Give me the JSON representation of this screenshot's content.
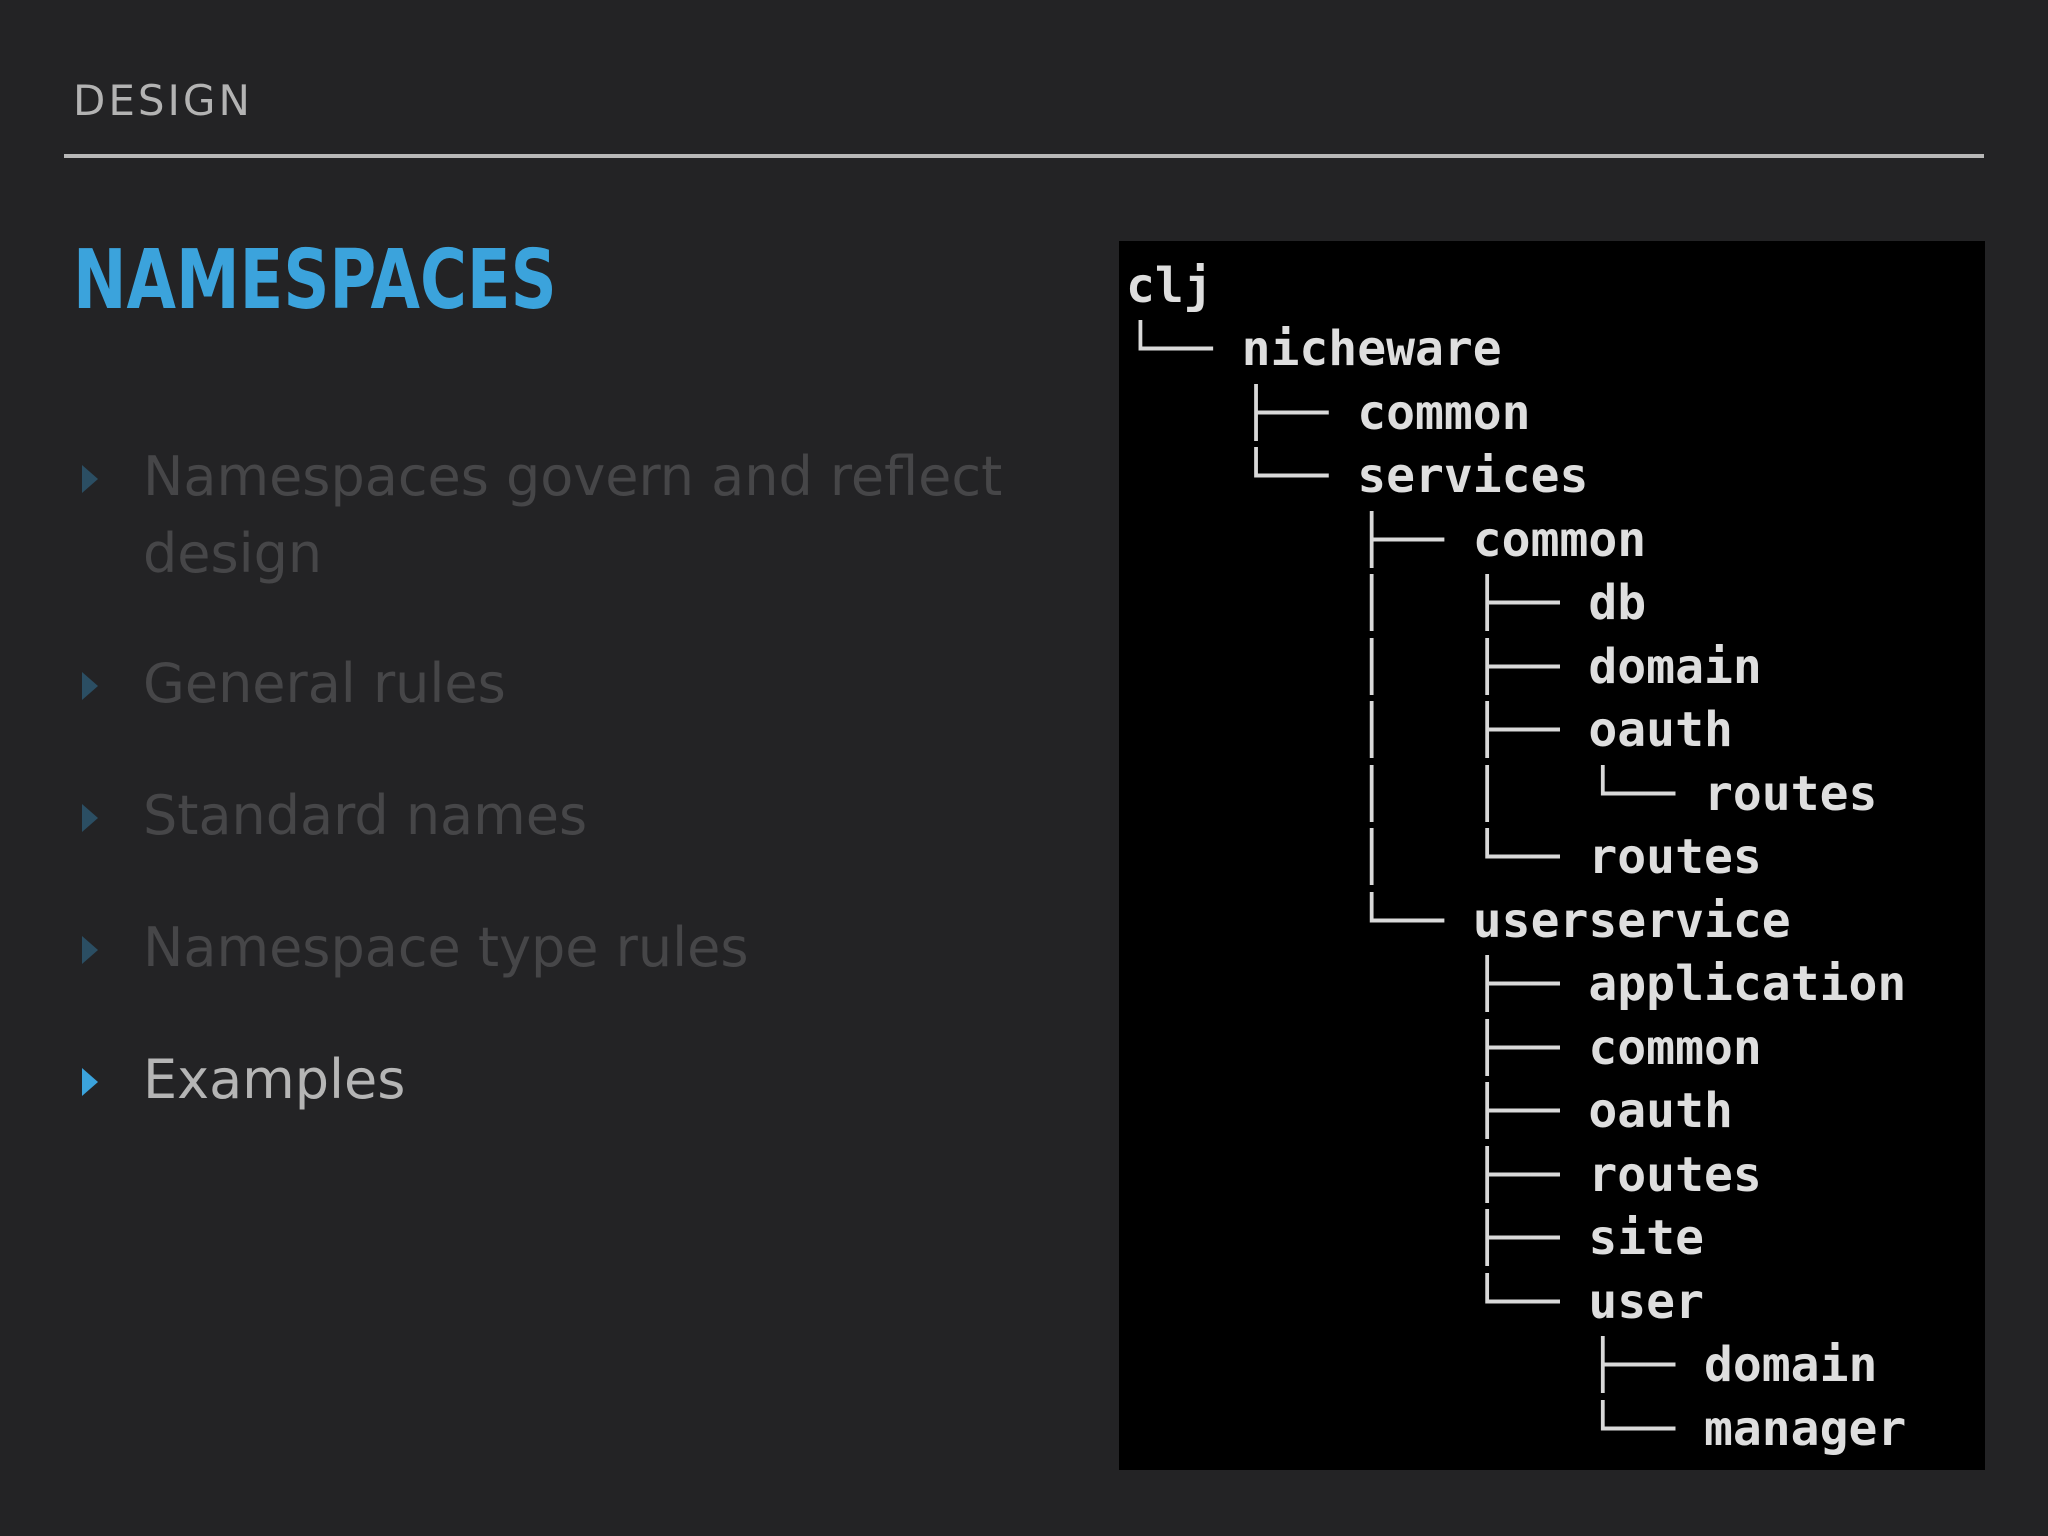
{
  "header": {
    "section": "DESIGN"
  },
  "title": "NAMESPACES",
  "bullets": [
    {
      "text": "Namespaces govern and reflect design",
      "active": false
    },
    {
      "text": "General rules",
      "active": false
    },
    {
      "text": "Standard names",
      "active": false
    },
    {
      "text": "Namespace type rules",
      "active": false
    },
    {
      "text": "Examples",
      "active": true
    }
  ],
  "terminal": {
    "lines": [
      {
        "prefix": "",
        "name": "clj"
      },
      {
        "prefix": "└── ",
        "name": "nicheware"
      },
      {
        "prefix": "    ├── ",
        "name": "common"
      },
      {
        "prefix": "    └── ",
        "name": "services"
      },
      {
        "prefix": "        ├── ",
        "name": "common"
      },
      {
        "prefix": "        │   ├── ",
        "name": "db"
      },
      {
        "prefix": "        │   ├── ",
        "name": "domain"
      },
      {
        "prefix": "        │   ├── ",
        "name": "oauth"
      },
      {
        "prefix": "        │   │   └── ",
        "name": "routes"
      },
      {
        "prefix": "        │   └── ",
        "name": "routes"
      },
      {
        "prefix": "        └── ",
        "name": "userservice"
      },
      {
        "prefix": "            ├── ",
        "name": "application"
      },
      {
        "prefix": "            ├── ",
        "name": "common"
      },
      {
        "prefix": "            ├── ",
        "name": "oauth"
      },
      {
        "prefix": "            ├── ",
        "name": "routes"
      },
      {
        "prefix": "            ├── ",
        "name": "site"
      },
      {
        "prefix": "            └── ",
        "name": "user"
      },
      {
        "prefix": "                ├── ",
        "name": "domain"
      },
      {
        "prefix": "                └── ",
        "name": "manager"
      }
    ]
  },
  "colors": {
    "background": "#232325",
    "accent": "#3ba3dc",
    "inactive_text": "#464648",
    "active_text": "#b5b5b5",
    "terminal_bg": "#000000"
  }
}
